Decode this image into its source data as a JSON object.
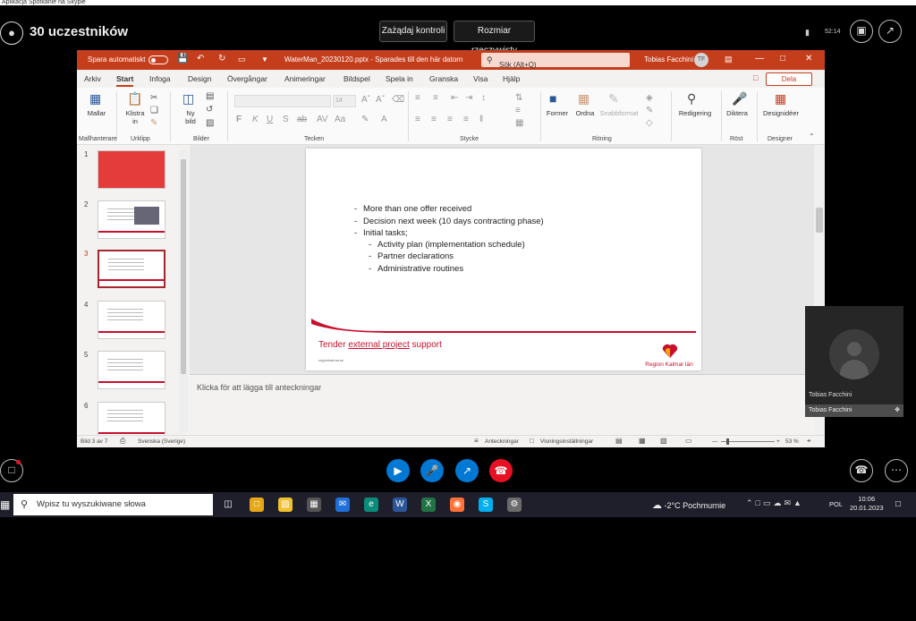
{
  "window": {
    "title": "Aplikacja Spotkanie na Skypie"
  },
  "skype": {
    "participants_label": "30 uczestników",
    "request_control": "Zażądaj kontroli",
    "actual_size": "Rozmiar rzeczywisty",
    "time": "52:14"
  },
  "ppt": {
    "autosave": "Spara automatiskt",
    "filename": "WaterMan_20230120.pptx - Sparades till den här datorn",
    "search": "Sök (Alt+Q)",
    "user": "Tobias Facchini",
    "user_initials": "TF",
    "share": "Dela",
    "tabs": [
      "Arkiv",
      "Start",
      "Infoga",
      "Design",
      "Övergångar",
      "Animeringar",
      "Bildspel",
      "Spela in",
      "Granska",
      "Visa",
      "Hjälp"
    ],
    "ribbon": {
      "paste_label_1": "Mallar",
      "klistra_1": "Klistra",
      "klistra_2": "in",
      "ny_1": "Ny",
      "ny_2": "bild",
      "font_size": "14",
      "former": "Former",
      "ordna": "Ordna",
      "snabbformat": "Snabbformat",
      "redigering": "Redigering",
      "diktera": "Diktera",
      "designideer": "Designidéer",
      "groups": {
        "mallhanterare": "Mallhanterare",
        "urklipp": "Urklipp",
        "bilder": "Bilder",
        "tecken": "Tecken",
        "stycke": "Stycke",
        "ritning": "Ritning",
        "rost": "Röst",
        "designer": "Designer"
      }
    },
    "thumbnails": [
      "1",
      "2",
      "3",
      "4",
      "5",
      "6"
    ],
    "slide": {
      "bullets": [
        "More than one offer received",
        "Decision next week (10 days contracting phase)",
        "Initial tasks;"
      ],
      "sub_bullets": [
        "Activity plan (implementation schedule)",
        "Partner declarations",
        "Administrative routines"
      ],
      "footer_a": "Tender ",
      "footer_b": "external project",
      "footer_c": " support",
      "url": "regionkalmar.se",
      "logo_text": "Region Kalmar län"
    },
    "notes_placeholder": "Klicka för att lägga till anteckningar",
    "status": {
      "slide": "Bild 3 av 7",
      "language": "Svenska (Sverige)",
      "notes": "Anteckningar",
      "view_settings": "Visningsinställningar",
      "zoom": "53 %"
    }
  },
  "selfview": {
    "name": "Tobias Facchini",
    "name_bar": "Tobias Facchini"
  },
  "taskbar": {
    "search": "Wpisz tu wyszukiwane słowa",
    "weather": "-2°C  Pochmurnie",
    "lang": "POL",
    "time": "10:06",
    "date": "20.01.2023"
  },
  "colors": {
    "ppt_red": "#c43e1c",
    "hangup": "#e81123",
    "call_blue": "#0078d4",
    "brand_red": "#c8102e"
  }
}
